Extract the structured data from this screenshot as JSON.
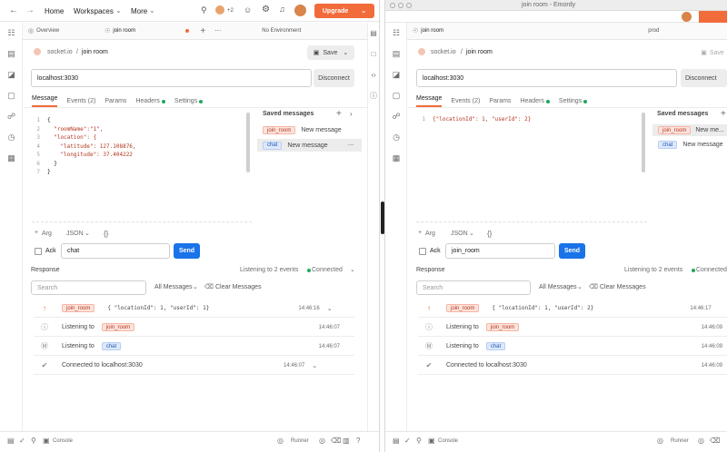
{
  "left": {
    "nav": {
      "home": "Home",
      "workspaces": "Workspaces",
      "more": "More",
      "avatar_count": "+2",
      "upgrade": "Upgrade"
    },
    "tabs": {
      "overview": "Overview",
      "active": "join room",
      "env": "No Environment"
    },
    "breadcrumb": {
      "collection": "socket.io",
      "request": "join room"
    },
    "save": "Save",
    "url": "localhost:3030",
    "disconnect": "Disconnect",
    "subtabs": {
      "message": "Message",
      "events": "Events (2)",
      "params": "Params",
      "headers": "Headers",
      "settings": "Settings"
    },
    "code_lines": [
      {
        "n": "1",
        "t": "{"
      },
      {
        "n": "2",
        "t": "  \"roomName\":\"1\","
      },
      {
        "n": "3",
        "t": "  \"location\": {"
      },
      {
        "n": "4",
        "t": "    \"latitude\": 127.108876,"
      },
      {
        "n": "5",
        "t": "    \"longitude\": 37.404222"
      },
      {
        "n": "6",
        "t": "  }"
      },
      {
        "n": "7",
        "t": "}"
      }
    ],
    "saved": {
      "title": "Saved messages",
      "items": [
        {
          "tag": "join_room",
          "text": "New message"
        },
        {
          "tag": "chat",
          "text": "New message"
        }
      ]
    },
    "arg": "Arg",
    "json": "JSON",
    "ack": "Ack",
    "event_input": "chat",
    "send": "Send",
    "response": {
      "title": "Response",
      "listening": "Listening to 2 events",
      "connected": "Connected",
      "search_placeholder": "Search",
      "all_messages": "All Messages",
      "clear": "Clear Messages"
    },
    "rows": [
      {
        "tag": "join_room",
        "text": "{ \"locationId\": 1, \"userId\": 1}",
        "time": "14:46:16"
      },
      {
        "prefix": "Listening to",
        "tag": "join_room",
        "time": "14:46:07"
      },
      {
        "prefix": "Listening to",
        "tag": "chat",
        "time": "14:46:07"
      },
      {
        "text": "Connected to localhost:3030",
        "time": "14:46:07"
      }
    ],
    "status": {
      "console": "Console",
      "runner": "Runner"
    }
  },
  "right": {
    "window_title": "join room - Emordy",
    "tab": "join room",
    "env": "prod",
    "breadcrumb": {
      "collection": "socket.io",
      "request": "join room"
    },
    "save": "Save",
    "url": "localhost:3030",
    "disconnect": "Disconnect",
    "subtabs": {
      "message": "Message",
      "events": "Events (2)",
      "params": "Params",
      "headers": "Headers",
      "settings": "Settings"
    },
    "code_lines": [
      {
        "n": "1",
        "t": "{\"locationId\": 1, \"userId\": 2}"
      }
    ],
    "saved": {
      "title": "Saved messages",
      "items": [
        {
          "tag": "join_room",
          "text": "New me..."
        },
        {
          "tag": "chat",
          "text": "New message"
        }
      ]
    },
    "arg": "Arg",
    "json": "JSON",
    "ack": "Ack",
    "event_input": "join_room",
    "send": "Send",
    "response": {
      "title": "Response",
      "listening": "Listening to 2 events",
      "connected": "Connected",
      "search_placeholder": "Search",
      "all_messages": "All Messages",
      "clear": "Clear Messages"
    },
    "rows": [
      {
        "tag": "join_room",
        "text": "{ \"locationId\": 1, \"userId\": 2}",
        "time": "14:46:17"
      },
      {
        "prefix": "Listening to",
        "tag": "join_room",
        "time": "14:46:09"
      },
      {
        "prefix": "Listening to",
        "tag": "chat",
        "time": "14:46:09"
      },
      {
        "text": "Connected to localhost:3030",
        "time": "14:46:09"
      }
    ],
    "status": {
      "console": "Console",
      "runner": "Runner"
    }
  },
  "colors": {
    "accent": "#f26b3a",
    "send": "#1a73e8",
    "connected": "#1faa57"
  }
}
